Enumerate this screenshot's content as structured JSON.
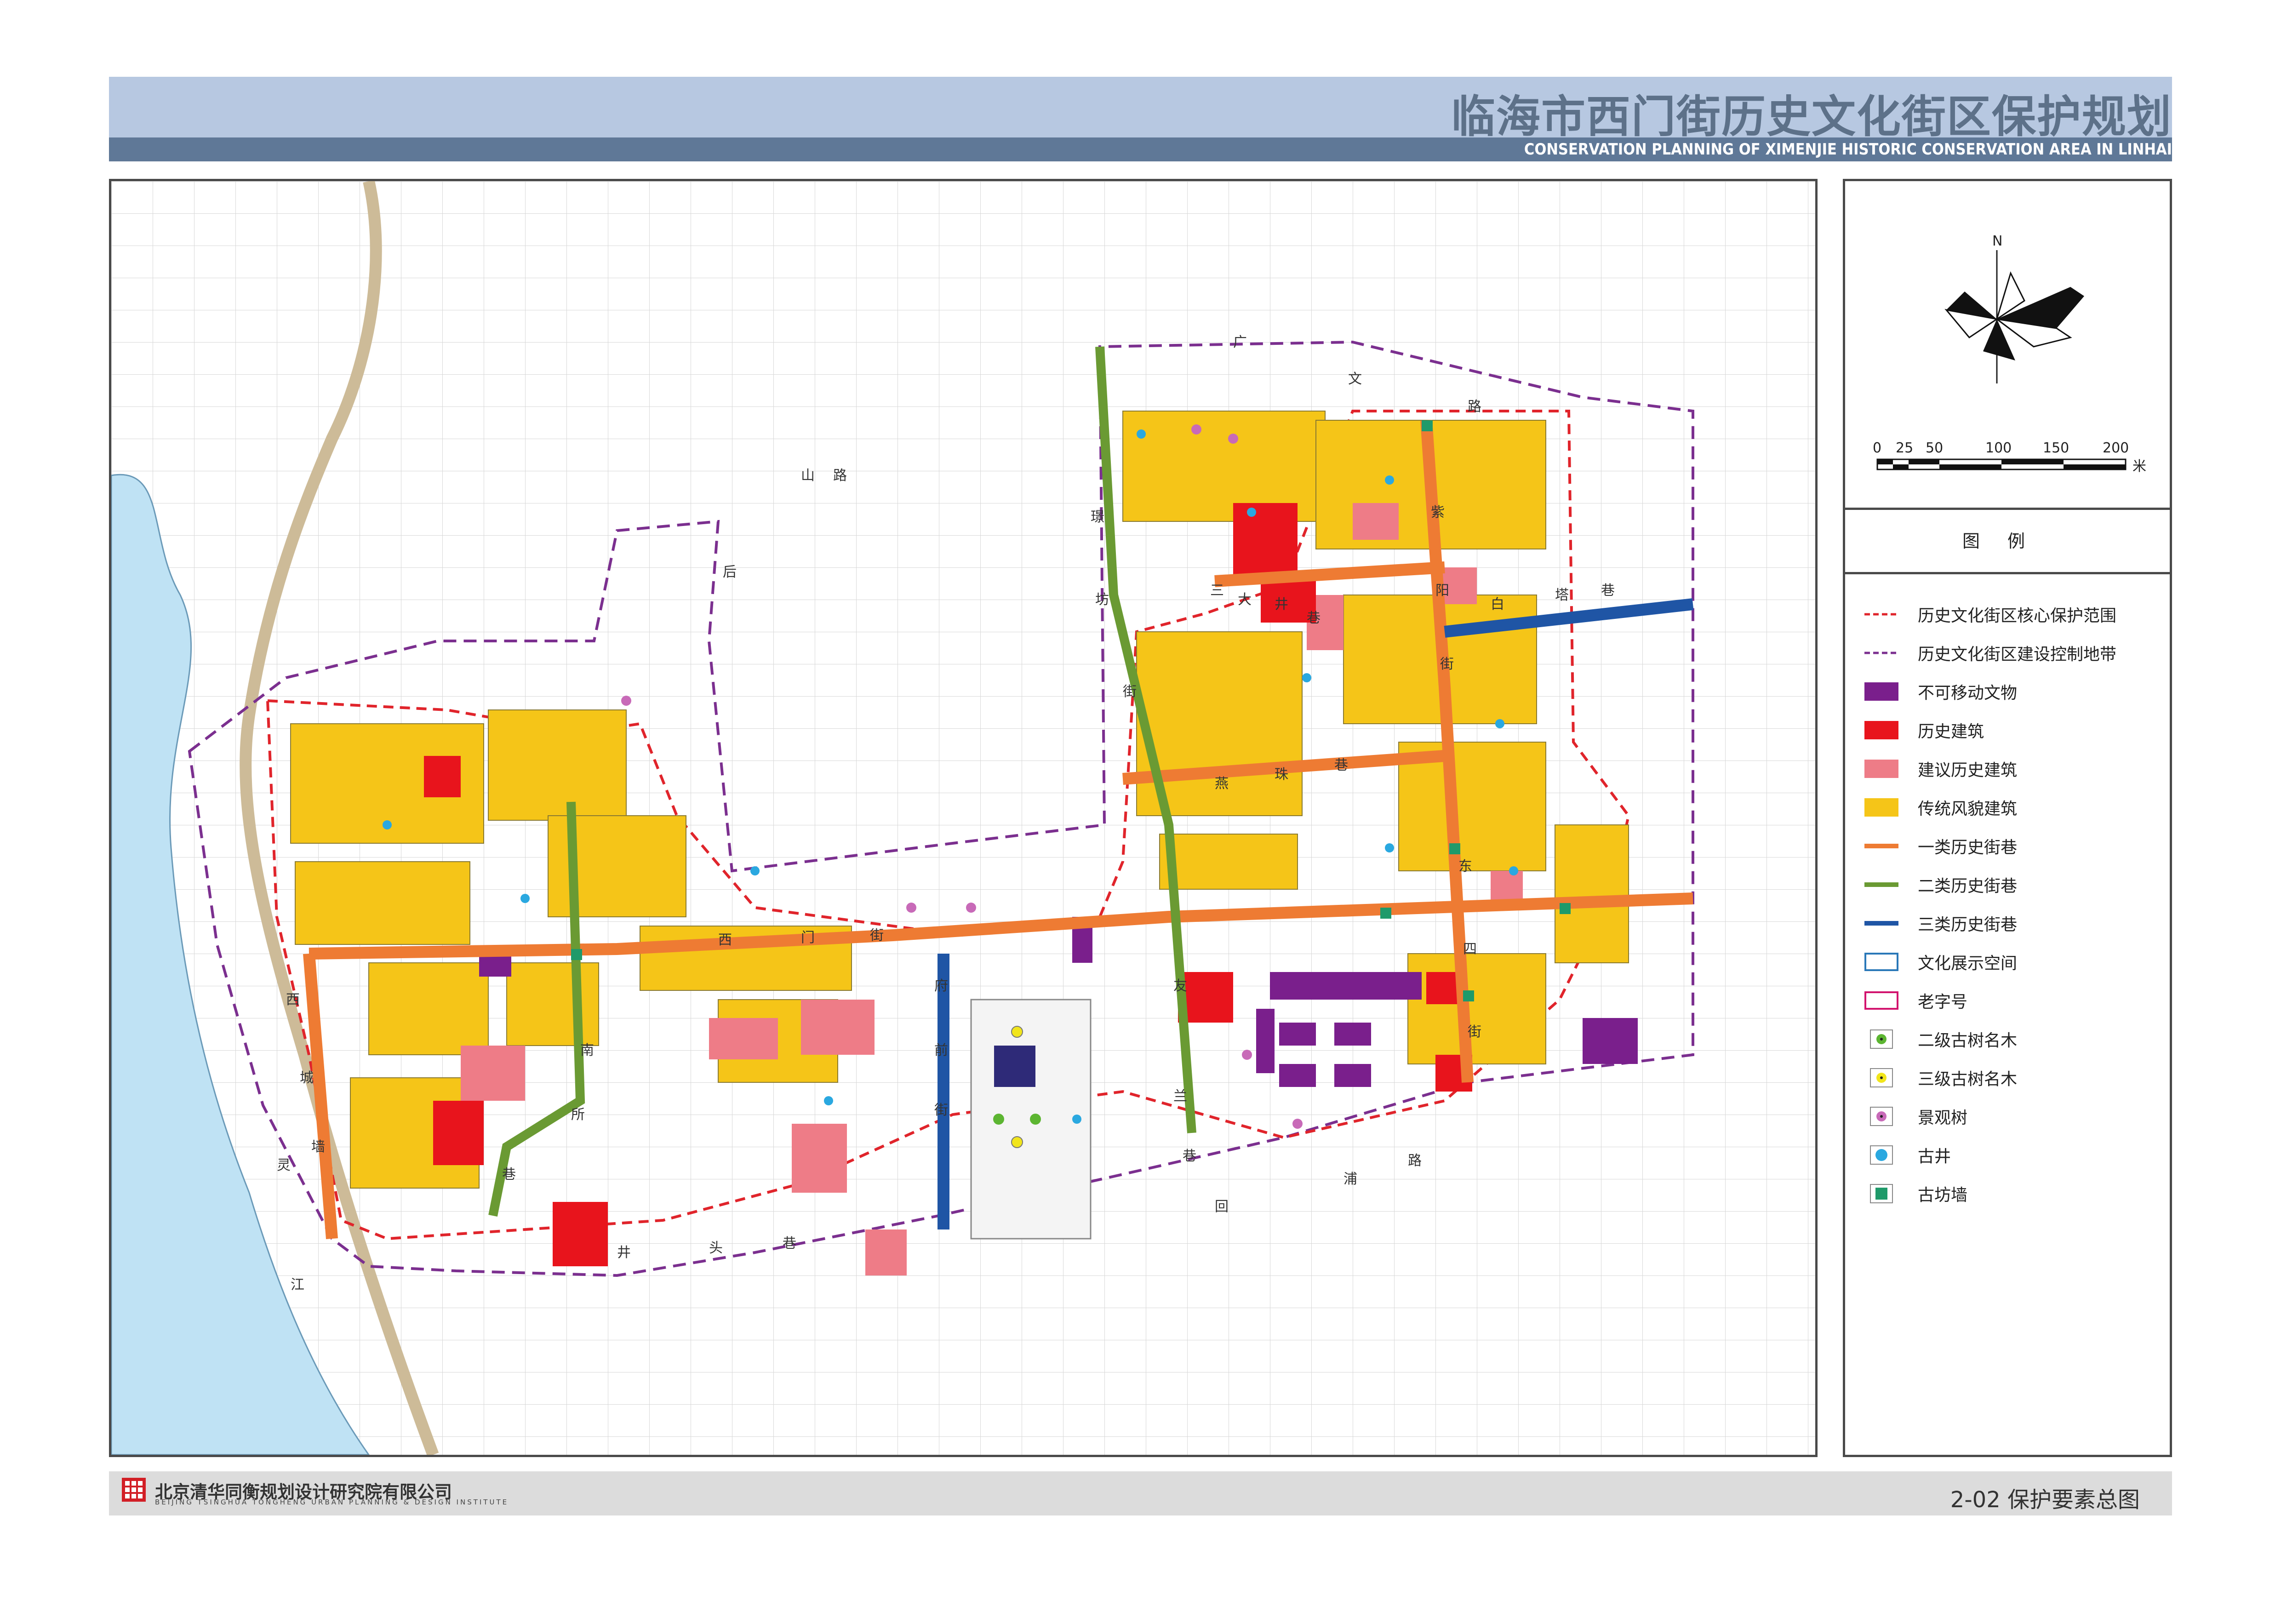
{
  "header": {
    "title_cn": "临海市西门街历史文化街区保护规划",
    "title_en": "CONSERVATION PLANNING OF XIMENJIE HISTORIC CONSERVATION AREA IN LINHAI"
  },
  "compass": {
    "north_label": "N"
  },
  "scale_bar": {
    "ticks": [
      "0",
      "25",
      "50",
      "100",
      "150",
      "200"
    ],
    "unit": "米"
  },
  "legend": {
    "title": "图例",
    "items": [
      {
        "label": "历史文化街区核心保护范围",
        "symbol": "dashed-red-line",
        "color": "#e0242b"
      },
      {
        "label": "历史文化街区建设控制地带",
        "symbol": "dashed-purple-line",
        "color": "#7b2f8f"
      },
      {
        "label": "不可移动文物",
        "symbol": "fill",
        "color": "#7a1f8c"
      },
      {
        "label": "历史建筑",
        "symbol": "fill",
        "color": "#e8141c"
      },
      {
        "label": "建议历史建筑",
        "symbol": "fill",
        "color": "#ee7c87"
      },
      {
        "label": "传统风貌建筑",
        "symbol": "fill",
        "color": "#f5c518"
      },
      {
        "label": "一类历史街巷",
        "symbol": "line",
        "color": "#ee7b33"
      },
      {
        "label": "二类历史街巷",
        "symbol": "line",
        "color": "#6a9a33"
      },
      {
        "label": "三类历史街巷",
        "symbol": "line",
        "color": "#1f55a5"
      },
      {
        "label": "文化展示空间",
        "symbol": "outline",
        "color": "#2a78b8"
      },
      {
        "label": "老字号",
        "symbol": "outline",
        "color": "#d2146e"
      },
      {
        "label": "二级古树名木",
        "symbol": "circle",
        "color": "#5cb531"
      },
      {
        "label": "三级古树名木",
        "symbol": "circle",
        "color": "#f1e51b"
      },
      {
        "label": "景观树",
        "symbol": "circle",
        "color": "#c86ab8"
      },
      {
        "label": "古井",
        "symbol": "circle",
        "color": "#2aa8e0"
      },
      {
        "label": "古坊墙",
        "symbol": "square",
        "color": "#1f9a6a"
      }
    ]
  },
  "map": {
    "river_label": [
      "灵",
      "江"
    ],
    "street_labels": [
      {
        "text": "广"
      },
      {
        "text": "文"
      },
      {
        "text": "路"
      },
      {
        "text": "山"
      },
      {
        "text": "路"
      },
      {
        "text": "后"
      },
      {
        "text": "璟"
      },
      {
        "text": "坊"
      },
      {
        "text": "街"
      },
      {
        "text": "三"
      },
      {
        "text": "大"
      },
      {
        "text": "井"
      },
      {
        "text": "巷"
      },
      {
        "text": "紫"
      },
      {
        "text": "阳"
      },
      {
        "text": "街"
      },
      {
        "text": "白"
      },
      {
        "text": "塔"
      },
      {
        "text": "巷"
      },
      {
        "text": "燕"
      },
      {
        "text": "珠"
      },
      {
        "text": "巷"
      },
      {
        "text": "西"
      },
      {
        "text": "门"
      },
      {
        "text": "街"
      },
      {
        "text": "西"
      },
      {
        "text": "城"
      },
      {
        "text": "墙"
      },
      {
        "text": "回"
      },
      {
        "text": "浦"
      },
      {
        "text": "路"
      },
      {
        "text": "府"
      },
      {
        "text": "前"
      },
      {
        "text": "街"
      },
      {
        "text": "友"
      },
      {
        "text": "兰"
      },
      {
        "text": "巷"
      },
      {
        "text": "井"
      },
      {
        "text": "头"
      },
      {
        "text": "巷"
      },
      {
        "text": "南"
      },
      {
        "text": "所"
      },
      {
        "text": "巷"
      },
      {
        "text": "东"
      },
      {
        "text": "四"
      },
      {
        "text": "街"
      }
    ]
  },
  "footer": {
    "org_cn": "北京清华同衡规划设计研究院有限公司",
    "org_en": "BEIJING TSINGHUA TONGHENG URBAN PLANNING & DESIGN INSTITUTE",
    "sheet": "2-02 保护要素总图"
  }
}
